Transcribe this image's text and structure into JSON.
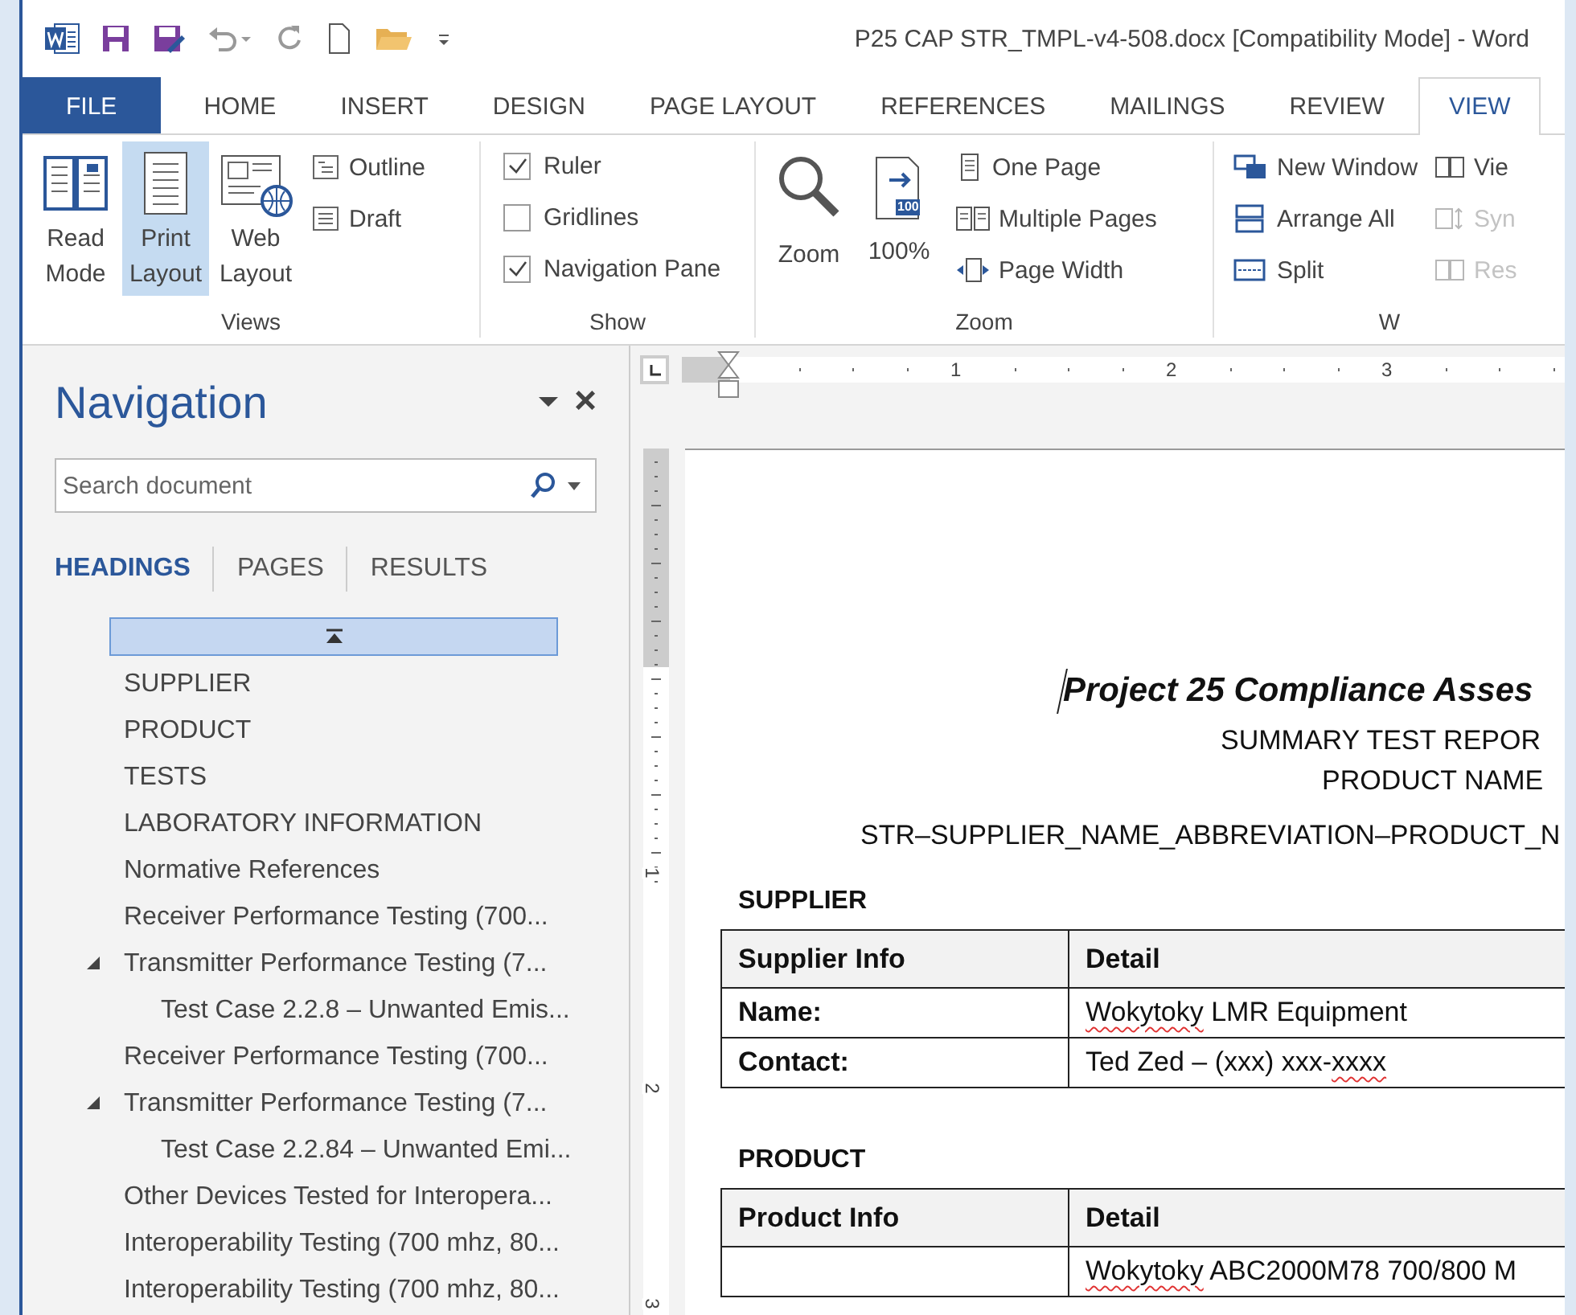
{
  "window": {
    "title": "P25 CAP STR_TMPL-v4-508.docx [Compatibility Mode] - Word"
  },
  "tabs": [
    {
      "label": "FILE",
      "kind": "file",
      "selected": false
    },
    {
      "label": "HOME",
      "kind": "tab",
      "selected": false
    },
    {
      "label": "INSERT",
      "kind": "tab",
      "selected": false
    },
    {
      "label": "DESIGN",
      "kind": "tab",
      "selected": false
    },
    {
      "label": "PAGE LAYOUT",
      "kind": "tab",
      "selected": false
    },
    {
      "label": "REFERENCES",
      "kind": "tab",
      "selected": false
    },
    {
      "label": "MAILINGS",
      "kind": "tab",
      "selected": false
    },
    {
      "label": "REVIEW",
      "kind": "tab",
      "selected": false
    },
    {
      "label": "VIEW",
      "kind": "tab",
      "selected": true
    }
  ],
  "ribbon": {
    "views": {
      "label": "Views",
      "read_mode": {
        "lines": [
          "Read",
          "Mode"
        ],
        "selected": false
      },
      "print_layout": {
        "lines": [
          "Print",
          "Layout"
        ],
        "selected": true
      },
      "web_layout": {
        "lines": [
          "Web",
          "Layout"
        ],
        "selected": false
      },
      "outline": "Outline",
      "draft": "Draft"
    },
    "show": {
      "label": "Show",
      "options": [
        {
          "label": "Ruler",
          "checked": true
        },
        {
          "label": "Gridlines",
          "checked": false
        },
        {
          "label": "Navigation Pane",
          "checked": true
        }
      ]
    },
    "zoom": {
      "label": "Zoom",
      "zoom": "Zoom",
      "percent": "100%",
      "badge": "100",
      "one_page": "One Page",
      "multiple_pages": "Multiple Pages",
      "page_width": "Page Width"
    },
    "window": {
      "label": "W",
      "new_window": "New Window",
      "arrange_all": "Arrange All",
      "split": "Split",
      "side_by_side": {
        "label": "Vie",
        "disabled": false
      },
      "sync": {
        "label": "Syn",
        "disabled": true
      },
      "reset": {
        "label": "Res",
        "disabled": true
      }
    }
  },
  "navigation": {
    "title": "Navigation",
    "close": "×",
    "search": {
      "placeholder": "Search document"
    },
    "tabs": [
      {
        "label": "HEADINGS",
        "selected": true
      },
      {
        "label": "PAGES",
        "selected": false
      },
      {
        "label": "RESULTS",
        "selected": false
      }
    ],
    "headings": [
      {
        "text": "SUPPLIER"
      },
      {
        "text": "PRODUCT"
      },
      {
        "text": "TESTS"
      },
      {
        "text": "LABORATORY INFORMATION"
      },
      {
        "text": "Normative References"
      },
      {
        "text": "Receiver Performance Testing (700..."
      },
      {
        "text": "Transmitter Performance Testing (7...",
        "expanded": true,
        "children": [
          {
            "text": "Test Case 2.2.8 – Unwanted Emis..."
          }
        ]
      },
      {
        "text": "Receiver Performance Testing (700..."
      },
      {
        "text": "Transmitter Performance Testing (7...",
        "expanded": true,
        "children": [
          {
            "text": "Test Case 2.2.84 – Unwanted Emi..."
          }
        ]
      },
      {
        "text": "Other Devices Tested for Interopera..."
      },
      {
        "text": "Interoperability Testing (700 mhz, 80..."
      },
      {
        "text": "Interoperability Testing (700 mhz, 80..."
      }
    ]
  },
  "ruler": {
    "horizontal": [
      "1",
      "2",
      "3"
    ],
    "vertical": [
      "1",
      "2",
      "3"
    ]
  },
  "document": {
    "title": "Project 25 Compliance Asses",
    "subtitle": "SUMMARY TEST REPOR",
    "product_name": "PRODUCT NAME",
    "reference": "STR–SUPPLIER_NAME_ABBREVIATION–PRODUCT_N",
    "sections": [
      {
        "heading": "SUPPLIER",
        "columns": [
          "Supplier Info",
          "Detail"
        ],
        "rows": [
          {
            "label": "Name:",
            "value": [
              {
                "text": "Wokytoky",
                "misspelled": true
              },
              {
                "text": " LMR Equipment",
                "misspelled": false
              }
            ]
          },
          {
            "label": "Contact:",
            "value": [
              {
                "text": "Ted Zed – (xxx) xxx-",
                "misspelled": false
              },
              {
                "text": "xxxx",
                "misspelled": true
              }
            ]
          }
        ]
      },
      {
        "heading": "PRODUCT",
        "columns": [
          "Product Info",
          "Detail"
        ],
        "rows": [
          {
            "value": [
              {
                "text": "Wokytoky",
                "misspelled": true
              },
              {
                "text": " ABC2000M78 700/800 M",
                "misspelled": false
              }
            ]
          }
        ]
      }
    ]
  }
}
